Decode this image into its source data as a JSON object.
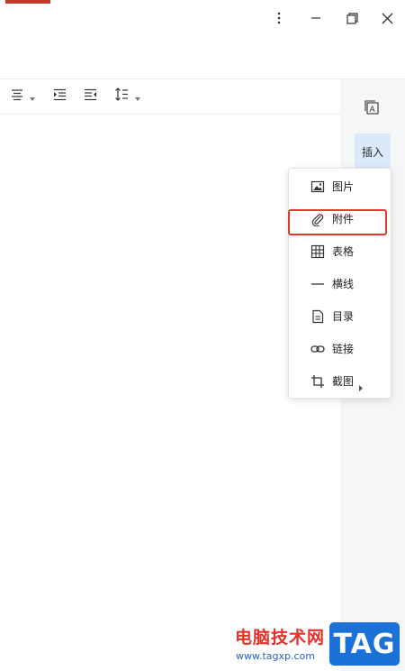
{
  "window": {
    "more_icon": "more-vertical-icon",
    "minimize_icon": "minimize-icon",
    "restore_icon": "restore-icon",
    "close_icon": "close-icon"
  },
  "toolbar": {
    "align_icon": "align-center-icon",
    "indent_icon": "indent-increase-icon",
    "outdent_icon": "indent-decrease-icon",
    "line_spacing_icon": "line-spacing-icon"
  },
  "sidebar": {
    "insert_tab_label": "插入",
    "style_icon": "text-style-icon",
    "active_color": "#dce8fb"
  },
  "insert_menu": {
    "items": [
      {
        "label": "图片",
        "icon": "image-icon"
      },
      {
        "label": "附件",
        "icon": "paperclip-icon"
      },
      {
        "label": "表格",
        "icon": "table-icon"
      },
      {
        "label": "横线",
        "icon": "horizontal-line-icon"
      },
      {
        "label": "目录",
        "icon": "document-icon"
      },
      {
        "label": "链接",
        "icon": "link-icon"
      },
      {
        "label": "截图",
        "icon": "crop-icon"
      }
    ],
    "highlight_color": "#e23a2c"
  },
  "watermark": {
    "site_name": "电脑技术网",
    "url": "www.tagxp.com",
    "badge": "TAG"
  }
}
